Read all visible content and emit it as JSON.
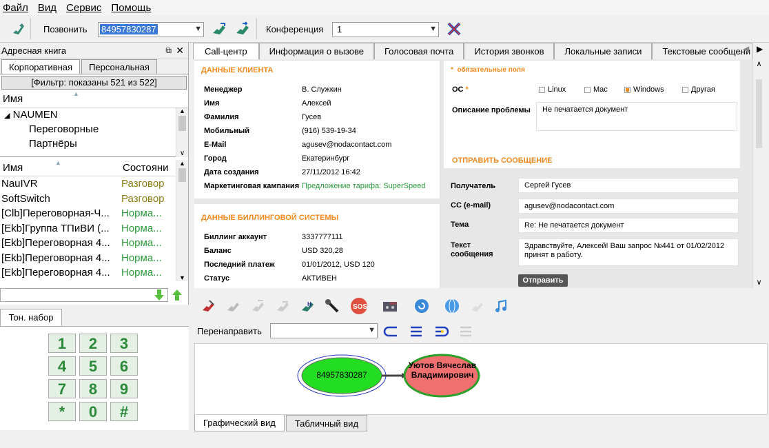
{
  "menu": [
    "Файл",
    "Вид",
    "Сервис",
    "Помощь"
  ],
  "toolbar": {
    "call_label": "Позвонить",
    "phone_value": "84957830287",
    "conference_label": "Конференция",
    "conference_value": "1"
  },
  "address_book": {
    "title": "Адресная книга",
    "tabs": [
      "Корпоративная",
      "Персональная"
    ],
    "filter": "[Фильтр: показаны 521 из 522]",
    "tree_header": "Имя",
    "tree": [
      "NAUMEN",
      "Переговорные",
      "Партнёры"
    ],
    "list_headers": [
      "Имя",
      "Состояни"
    ],
    "list": [
      {
        "name": "NauIVR",
        "status": "Разговор"
      },
      {
        "name": "SoftSwitch",
        "status": "Разговор"
      },
      {
        "name": "[Clb]Переговорная-Ч...",
        "status": "Норма..."
      },
      {
        "name": "[Ekb]Группа ТПиВИ (...",
        "status": "Норма..."
      },
      {
        "name": "[Ekb]Переговорная 4...",
        "status": "Норма..."
      },
      {
        "name": "[Ekb]Переговорная 4...",
        "status": "Норма..."
      },
      {
        "name": "[Ekb]Переговорная 4...",
        "status": "Норма..."
      }
    ]
  },
  "dialpad": {
    "tab": "Тон. набор",
    "keys": [
      "1",
      "2",
      "3",
      "4",
      "5",
      "6",
      "7",
      "8",
      "9",
      "*",
      "0",
      "#"
    ]
  },
  "right_tabs": [
    "Call-центр",
    "Информация о вызове",
    "Голосовая почта",
    "История звонков",
    "Локальные записи",
    "Текстовые сообщени"
  ],
  "client": {
    "title": "ДАННЫЕ КЛИЕНТА",
    "rows": [
      {
        "label": "Менеджер",
        "value": "В. Служкин"
      },
      {
        "label": "Имя",
        "value": "Алексей"
      },
      {
        "label": "Фамилия",
        "value": "Гусев"
      },
      {
        "label": "Мобильный",
        "value": "(916) 539-19-34"
      },
      {
        "label": "E-Mail",
        "value": "agusev@nodacontact.com"
      },
      {
        "label": "Город",
        "value": "Екатеринбург"
      },
      {
        "label": "Дата создания",
        "value": "27/11/2012 16:42"
      },
      {
        "label": "Маркетинговая кампания",
        "value": "Предложение тарифа: SuperSpeed"
      }
    ]
  },
  "billing": {
    "title": "ДАННЫЕ БИЛЛИНГОВОЙ СИСТЕМЫ",
    "rows": [
      {
        "label": "Биллинг аккаунт",
        "value": "3337777111"
      },
      {
        "label": "Баланс",
        "value": "USD 320,28"
      },
      {
        "label": "Последний платеж",
        "value": "01/01/2012, USD 120"
      },
      {
        "label": "Статус",
        "value": "АКТИВЕН"
      }
    ]
  },
  "form": {
    "required_note": "обязательные поля",
    "os_label": "ОС",
    "os_options": [
      "Linux",
      "Mac",
      "Windows",
      "Другая"
    ],
    "os_selected": "Windows",
    "problem_label": "Описание проблемы",
    "problem_value": "Не печатается документ"
  },
  "message": {
    "title": "ОТПРАВИТЬ СООБЩЕНИЕ",
    "to_label": "Получатель",
    "to_value": "Сергей Гусев",
    "cc_label": "CC (e-mail)",
    "cc_value": "agusev@nodacontact.com",
    "subject_label": "Тема",
    "subject_value": "Re: Не печатается документ",
    "text_label": "Текст сообщения",
    "text_value": "Здравствуйте, Алексей! Ваш запрос №441 от 01/02/2012 принят в работу.",
    "send_label": "Отправить"
  },
  "redirect_label": "Перенаправить",
  "graph": {
    "caller": "84957830287",
    "callee": "Уютов Вячеслав Владимирович"
  },
  "bottom_tabs": [
    "Графический вид",
    "Табличный вид"
  ],
  "colors": {
    "accent": "#f08a20",
    "green_node": "#22dd22",
    "red_node": "#f07070",
    "status_talk": "#8a7a10",
    "status_normal": "#2a9a3a"
  }
}
